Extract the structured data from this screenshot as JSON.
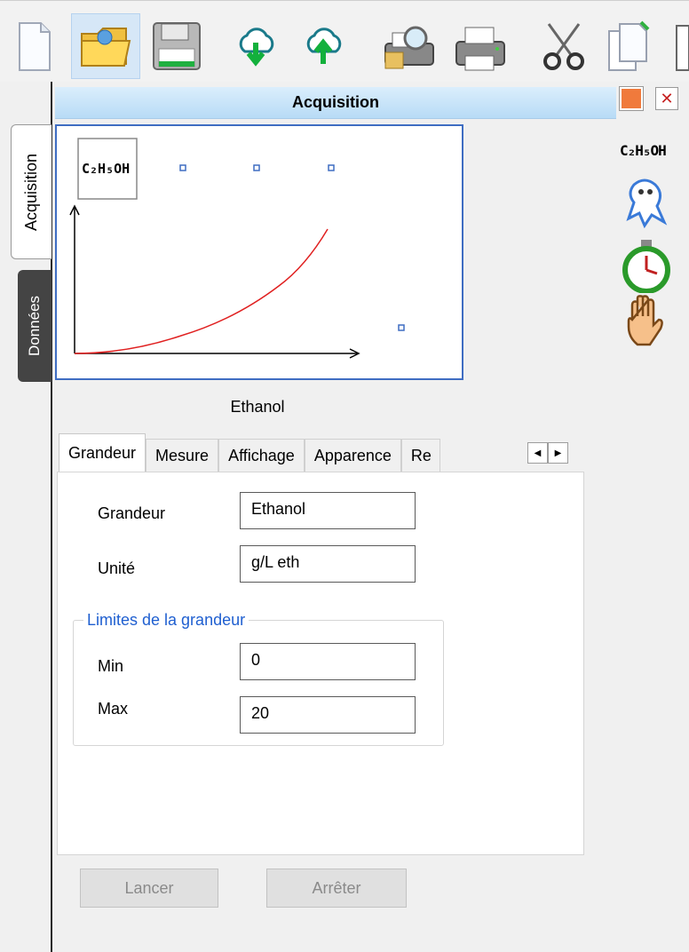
{
  "toolbar": {
    "buttons": [
      {
        "name": "new-document-icon"
      },
      {
        "name": "open-folder-icon"
      },
      {
        "name": "save-icon"
      },
      {
        "name": "cloud-download-icon"
      },
      {
        "name": "cloud-upload-icon"
      },
      {
        "name": "print-preview-icon"
      },
      {
        "name": "print-icon"
      },
      {
        "name": "cut-icon"
      },
      {
        "name": "copy-icon"
      }
    ]
  },
  "side_tabs": {
    "acquisition": "Acquisition",
    "donnees": "Données"
  },
  "panel": {
    "title": "Acquisition"
  },
  "right_icons": {
    "formula": "C₂H₅OH",
    "items": [
      "ghost-icon",
      "stopwatch-icon",
      "hand-stop-icon"
    ]
  },
  "chart": {
    "badge": "C₂H₅OH",
    "label": "Ethanol"
  },
  "tabs": [
    "Grandeur",
    "Mesure",
    "Affichage",
    "Apparence",
    "Re"
  ],
  "form": {
    "grandeur_label": "Grandeur",
    "grandeur_value": "Ethanol",
    "unite_label": "Unité",
    "unite_value": "g/L eth",
    "limits_title": "Limites de la grandeur",
    "min_label": "Min",
    "min_value": "0",
    "max_label": "Max",
    "max_value": "20"
  },
  "actions": {
    "lancer": "Lancer",
    "arreter": "Arrêter"
  },
  "colors": {
    "accent": "#3f6dc2",
    "curve": "#e02020",
    "legend": "#1f5fd0"
  }
}
